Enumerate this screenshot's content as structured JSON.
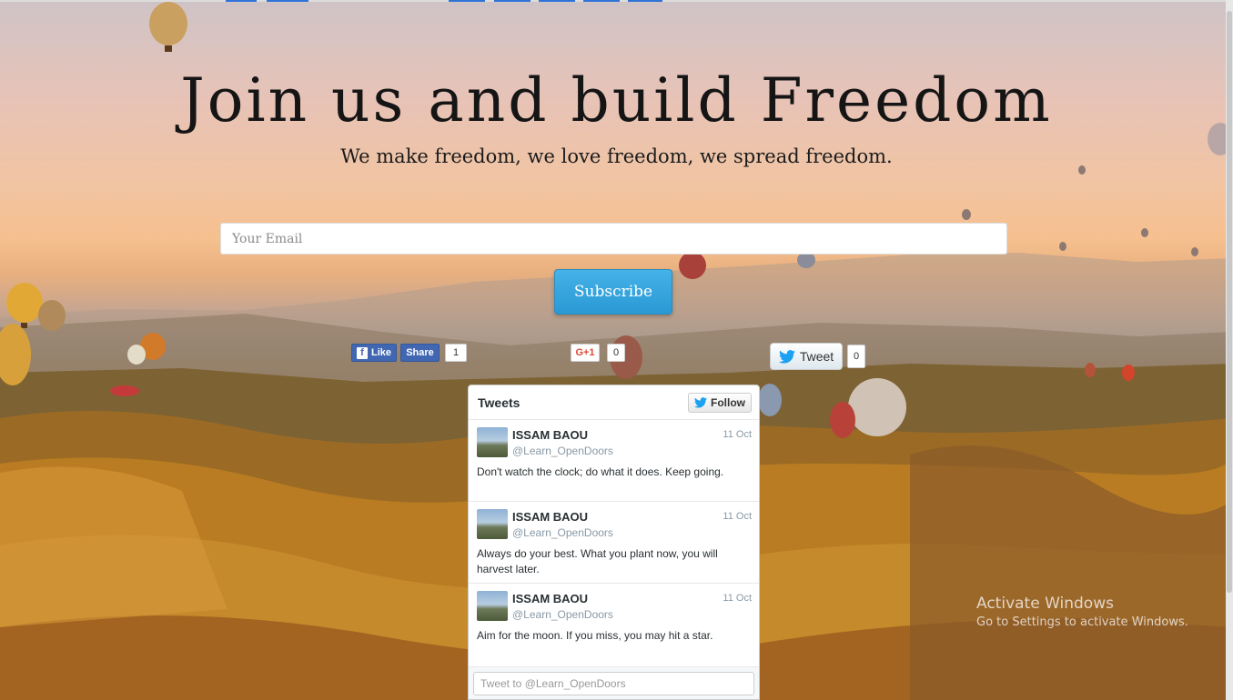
{
  "hero": {
    "title": "Join us and build Freedom",
    "subtitle": "We make freedom, we love freedom, we spread freedom."
  },
  "signup": {
    "email_placeholder": "Your Email",
    "subscribe_label": "Subscribe"
  },
  "social": {
    "fb_like_label": "Like",
    "fb_share_label": "Share",
    "fb_count": "1",
    "gplus_label": "G+1",
    "gplus_count": "0",
    "tweet_label": "Tweet",
    "tweet_count": "0"
  },
  "timeline": {
    "title": "Tweets",
    "follow_label": "Follow",
    "tweets": [
      {
        "name": "ISSAM BAOU",
        "handle": "@Learn_OpenDoors",
        "date": "11 Oct",
        "text": "Don't watch the clock; do what it does. Keep going."
      },
      {
        "name": "ISSAM BAOU",
        "handle": "@Learn_OpenDoors",
        "date": "11 Oct",
        "text": "Always do your best. What you plant now, you will harvest later."
      },
      {
        "name": "ISSAM BAOU",
        "handle": "@Learn_OpenDoors",
        "date": "11 Oct",
        "text": "Aim for the moon. If you miss, you may hit a star."
      }
    ],
    "tweet_box_placeholder": "Tweet to @Learn_OpenDoors"
  },
  "watermark": {
    "line1": "Activate Windows",
    "line2": "Go to Settings to activate Windows."
  },
  "colors": {
    "subscribe": "#2a98d4",
    "facebook": "#4267b2",
    "gplus": "#dd4b39",
    "twitter": "#1da1f2"
  }
}
